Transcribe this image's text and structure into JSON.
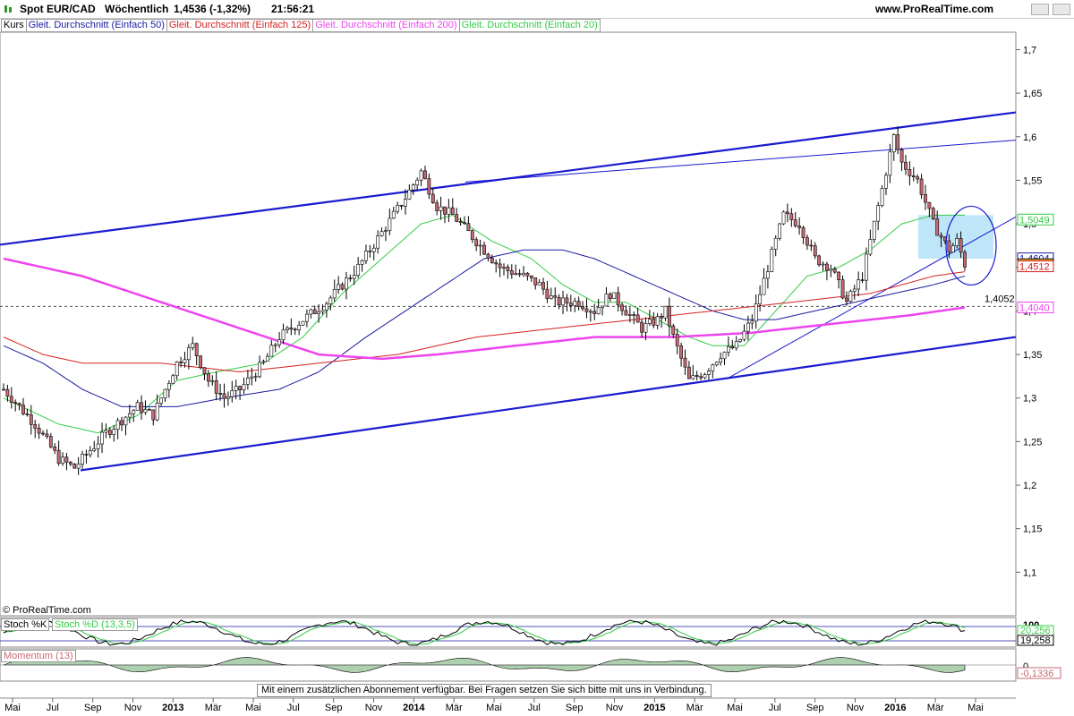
{
  "window": {
    "title": "Spot EUR/CAD",
    "interval": "Wöchentlich",
    "last": "1,4536 (-1,32%)",
    "time": "21:56:21",
    "brand": "www.ProRealTime.com"
  },
  "legend": [
    {
      "label": "Kurs",
      "color": "#000000"
    },
    {
      "label": "Gleit. Durchschnitt (Einfach 50)",
      "color": "#1a1aa0"
    },
    {
      "label": "Gleit. Durchschnitt (Einfach 125)",
      "color": "#d42020"
    },
    {
      "label": "Gleit. Durchschnitt (Einfach 200)",
      "color": "#ee44ee"
    },
    {
      "label": "Gleit. Durchschnitt (Einfach 20)",
      "color": "#33cc44"
    }
  ],
  "copyright": "© ProRealTime.com",
  "footer_note": "Mit einem zusätzlichen Abonnement verfügbar. Bei Fragen setzen Sie sich bitte mit uns in Verbindung.",
  "colors": {
    "up": "#ffffff",
    "down": "#c76a74",
    "grid": "#d8d8d8",
    "highlight": "#bfe6f8",
    "circle": "#1a1ad0"
  },
  "chart_data": {
    "type": "candlestick",
    "title": "Spot EUR/CAD",
    "ylim": [
      1.05,
      1.72
    ],
    "y_ticks": [
      "1,7",
      "1,65",
      "1,6",
      "1,55",
      "1,5",
      "1,45",
      "1,4",
      "1,35",
      "1,3",
      "1,25",
      "1,2",
      "1,15",
      "1,1"
    ],
    "x_ticks": [
      "Mai",
      "Jul",
      "Sep",
      "Nov",
      "2013",
      "Mär",
      "Mai",
      "Jul",
      "Sep",
      "Nov",
      "2014",
      "Mär",
      "Mai",
      "Jul",
      "Sep",
      "Nov",
      "2015",
      "Mär",
      "Mai",
      "Jul",
      "Sep",
      "Nov",
      "2016",
      "Mär",
      "Mai"
    ],
    "price_key_points": [
      [
        0,
        1.31
      ],
      [
        8,
        1.27
      ],
      [
        14,
        1.23
      ],
      [
        18,
        1.22
      ],
      [
        26,
        1.26
      ],
      [
        34,
        1.29
      ],
      [
        38,
        1.28
      ],
      [
        44,
        1.34
      ],
      [
        48,
        1.36
      ],
      [
        52,
        1.32
      ],
      [
        56,
        1.3
      ],
      [
        60,
        1.31
      ],
      [
        66,
        1.34
      ],
      [
        70,
        1.37
      ],
      [
        76,
        1.39
      ],
      [
        82,
        1.41
      ],
      [
        90,
        1.45
      ],
      [
        96,
        1.49
      ],
      [
        102,
        1.53
      ],
      [
        106,
        1.56
      ],
      [
        110,
        1.52
      ],
      [
        114,
        1.51
      ],
      [
        120,
        1.48
      ],
      [
        126,
        1.45
      ],
      [
        132,
        1.44
      ],
      [
        136,
        1.43
      ],
      [
        140,
        1.41
      ],
      [
        146,
        1.41
      ],
      [
        150,
        1.4
      ],
      [
        154,
        1.42
      ],
      [
        158,
        1.4
      ],
      [
        162,
        1.38
      ],
      [
        166,
        1.39
      ],
      [
        168,
        1.4
      ],
      [
        170,
        1.37
      ],
      [
        174,
        1.32
      ],
      [
        178,
        1.33
      ],
      [
        182,
        1.35
      ],
      [
        186,
        1.36
      ],
      [
        190,
        1.39
      ],
      [
        194,
        1.45
      ],
      [
        198,
        1.51
      ],
      [
        202,
        1.5
      ],
      [
        206,
        1.46
      ],
      [
        210,
        1.45
      ],
      [
        214,
        1.41
      ],
      [
        218,
        1.44
      ],
      [
        222,
        1.52
      ],
      [
        226,
        1.6
      ],
      [
        228,
        1.57
      ],
      [
        232,
        1.55
      ],
      [
        236,
        1.5
      ],
      [
        240,
        1.47
      ],
      [
        242,
        1.48
      ],
      [
        244,
        1.4536
      ]
    ],
    "ma_key_points": {
      "sma20": [
        [
          0,
          1.3
        ],
        [
          14,
          1.27
        ],
        [
          24,
          1.26
        ],
        [
          34,
          1.28
        ],
        [
          44,
          1.32
        ],
        [
          54,
          1.33
        ],
        [
          66,
          1.34
        ],
        [
          76,
          1.37
        ],
        [
          86,
          1.42
        ],
        [
          96,
          1.46
        ],
        [
          106,
          1.5
        ],
        [
          114,
          1.51
        ],
        [
          124,
          1.48
        ],
        [
          134,
          1.46
        ],
        [
          142,
          1.43
        ],
        [
          150,
          1.41
        ],
        [
          158,
          1.41
        ],
        [
          166,
          1.39
        ],
        [
          174,
          1.37
        ],
        [
          180,
          1.36
        ],
        [
          188,
          1.36
        ],
        [
          196,
          1.4
        ],
        [
          204,
          1.44
        ],
        [
          212,
          1.45
        ],
        [
          220,
          1.47
        ],
        [
          228,
          1.5
        ],
        [
          236,
          1.51
        ],
        [
          244,
          1.51
        ]
      ],
      "sma50": [
        [
          0,
          1.36
        ],
        [
          10,
          1.34
        ],
        [
          20,
          1.31
        ],
        [
          30,
          1.29
        ],
        [
          44,
          1.29
        ],
        [
          56,
          1.3
        ],
        [
          70,
          1.31
        ],
        [
          80,
          1.33
        ],
        [
          92,
          1.37
        ],
        [
          102,
          1.4
        ],
        [
          112,
          1.43
        ],
        [
          122,
          1.46
        ],
        [
          132,
          1.47
        ],
        [
          142,
          1.47
        ],
        [
          150,
          1.46
        ],
        [
          160,
          1.44
        ],
        [
          170,
          1.42
        ],
        [
          180,
          1.4
        ],
        [
          188,
          1.39
        ],
        [
          196,
          1.39
        ],
        [
          206,
          1.4
        ],
        [
          216,
          1.41
        ],
        [
          226,
          1.42
        ],
        [
          236,
          1.43
        ],
        [
          244,
          1.44
        ]
      ],
      "sma125": [
        [
          0,
          1.37
        ],
        [
          10,
          1.35
        ],
        [
          20,
          1.34
        ],
        [
          40,
          1.34
        ],
        [
          60,
          1.33
        ],
        [
          80,
          1.34
        ],
        [
          100,
          1.35
        ],
        [
          120,
          1.37
        ],
        [
          140,
          1.38
        ],
        [
          160,
          1.39
        ],
        [
          180,
          1.4
        ],
        [
          200,
          1.41
        ],
        [
          220,
          1.42
        ],
        [
          236,
          1.44
        ],
        [
          244,
          1.445
        ]
      ],
      "sma200": [
        [
          0,
          1.46
        ],
        [
          20,
          1.44
        ],
        [
          40,
          1.41
        ],
        [
          60,
          1.38
        ],
        [
          80,
          1.35
        ],
        [
          96,
          1.345
        ],
        [
          110,
          1.35
        ],
        [
          130,
          1.36
        ],
        [
          150,
          1.37
        ],
        [
          170,
          1.37
        ],
        [
          190,
          1.375
        ],
        [
          210,
          1.385
        ],
        [
          230,
          1.395
        ],
        [
          244,
          1.404
        ]
      ]
    },
    "price_labels": [
      {
        "value": "1,5049",
        "color": "#33cc44"
      },
      {
        "value": "1,4604",
        "color": "#1a1aa0"
      },
      {
        "value": "1,4536",
        "color": "#000000",
        "bg": "#f2b233"
      },
      {
        "value": "1,4512",
        "color": "#d42020"
      },
      {
        "value": "1,4040",
        "color": "#ee44ee"
      }
    ],
    "reference_line": {
      "value": 1.4052,
      "label": "1,4052"
    },
    "stochastic": {
      "labels": [
        "Stoch %K",
        "Stoch %D (13,3,5)"
      ],
      "k_last": "20,256",
      "d_last": "19,258",
      "top_label": "100"
    },
    "momentum": {
      "label": "Momentum (13)",
      "last": "-0,1336",
      "zero_label": "0"
    }
  }
}
